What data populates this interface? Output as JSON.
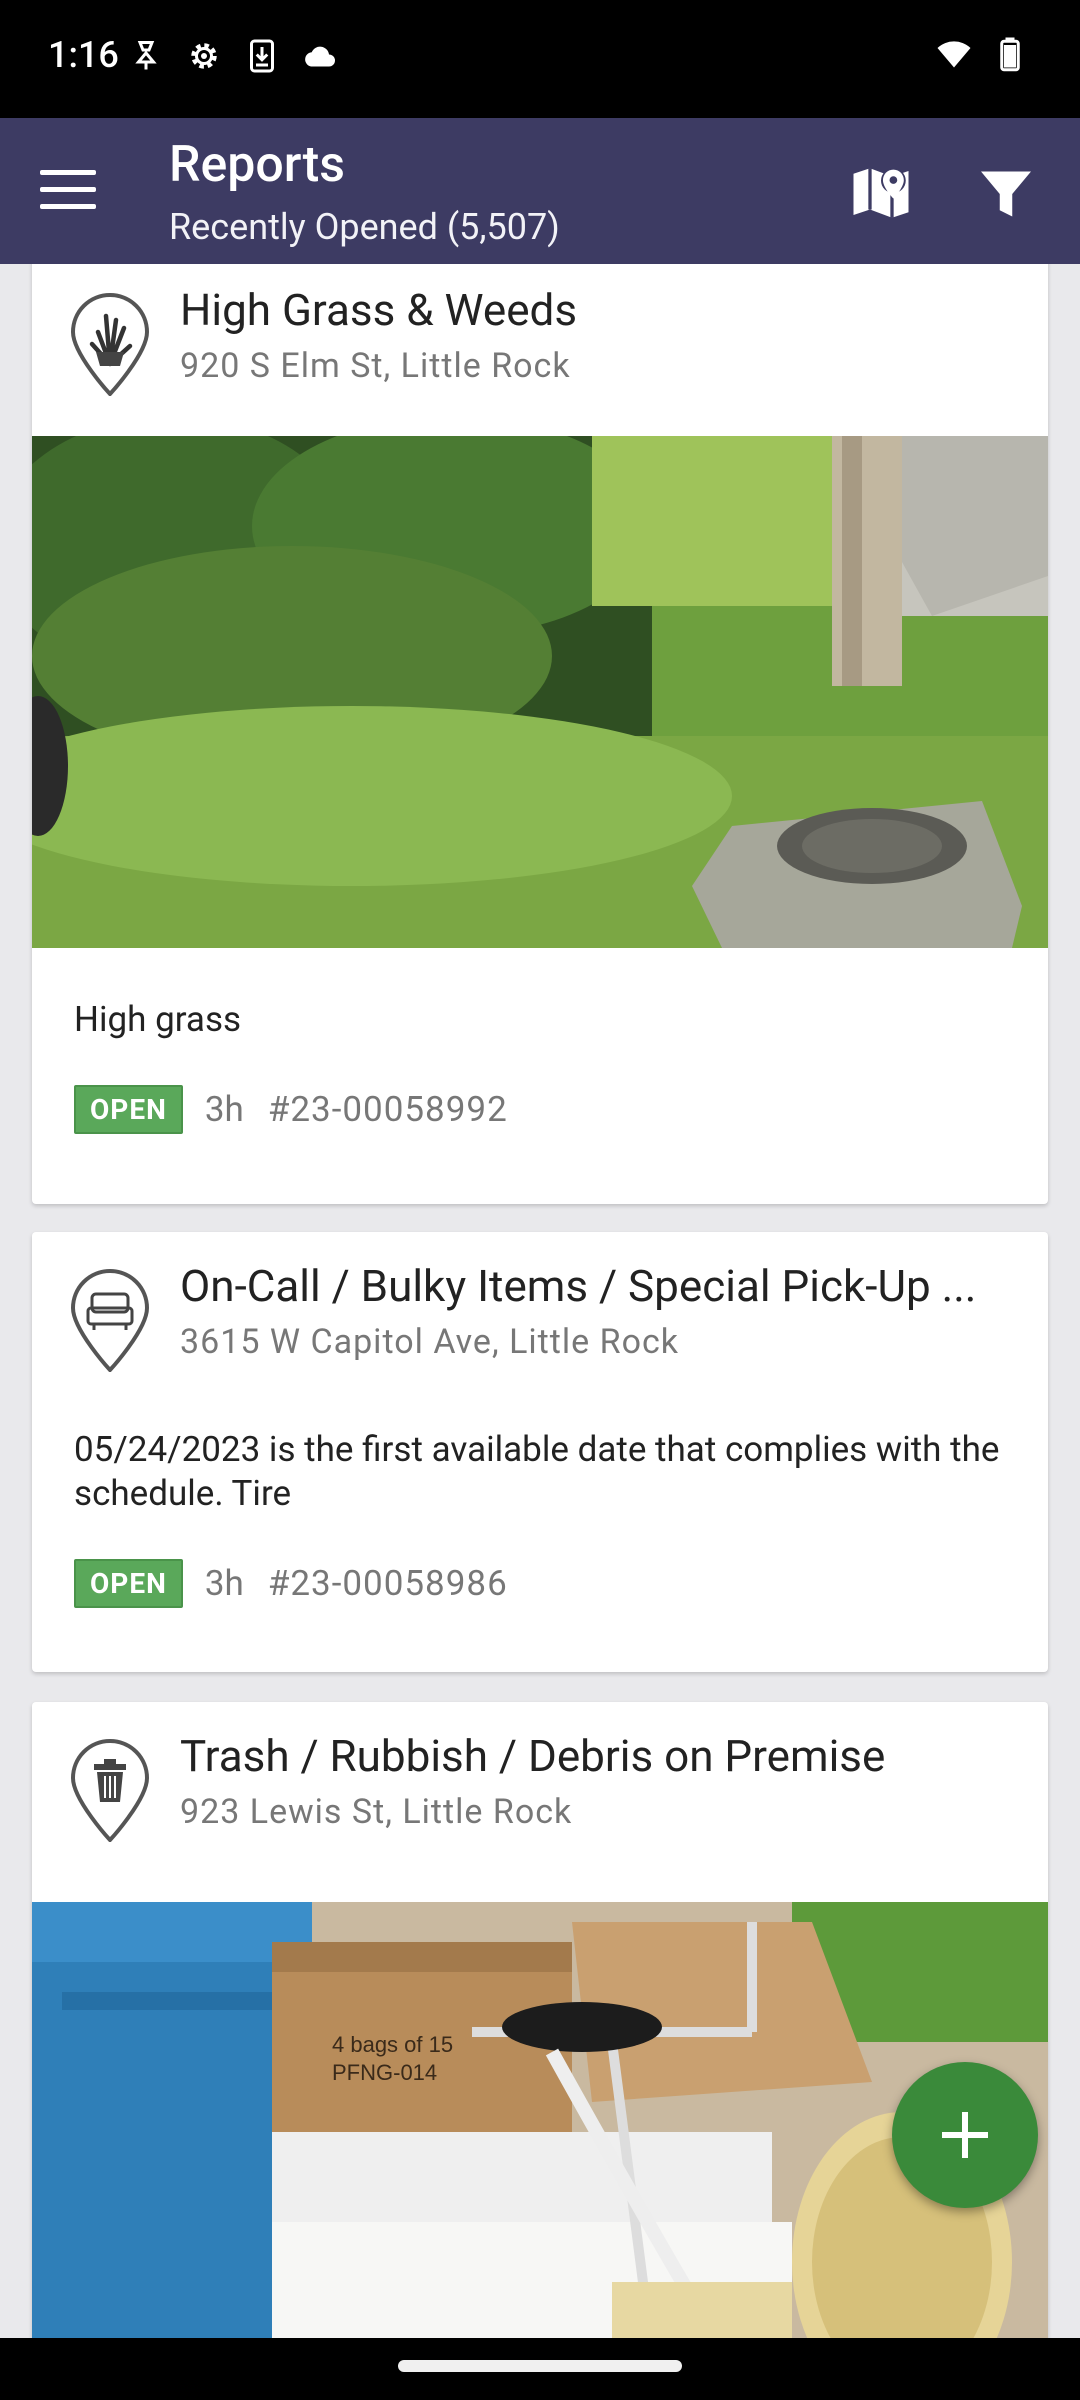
{
  "status_bar": {
    "time": "1:16",
    "left_icons": [
      "hotspot-icon",
      "settings-icon",
      "download-icon",
      "cloud-icon"
    ],
    "right_icons": [
      "wifi-icon",
      "battery-icon"
    ]
  },
  "app_bar": {
    "title": "Reports",
    "subtitle": "Recently Opened (5,507)",
    "color": "#3d3b63",
    "icons": [
      "menu-icon",
      "map-pin-icon",
      "filter-icon"
    ]
  },
  "reports": [
    {
      "title": "High Grass & Weeds",
      "address": "920 S Elm St, Little Rock",
      "icon": "grass-icon",
      "description": "High grass",
      "status": "OPEN",
      "age": "3h",
      "id": "#23-00058992"
    },
    {
      "title": "On-Call / Bulky Items / Special Pick-Up ...",
      "address": "3615 W Capitol Ave, Little Rock",
      "icon": "sofa-icon",
      "description": "05/24/2023 is the first available date that complies with the schedule. Tire",
      "status": "OPEN",
      "age": "3h",
      "id": "#23-00058986"
    },
    {
      "title": "Trash / Rubbish / Debris on Premise",
      "address": "923 Lewis St, Little Rock",
      "icon": "trash-can-icon",
      "photo_text": "4 bags of 15\nPFNG-014"
    }
  ],
  "fab": {
    "icon": "plus-icon",
    "color": "#3a8a3a"
  },
  "status_color": "#5aa85a"
}
